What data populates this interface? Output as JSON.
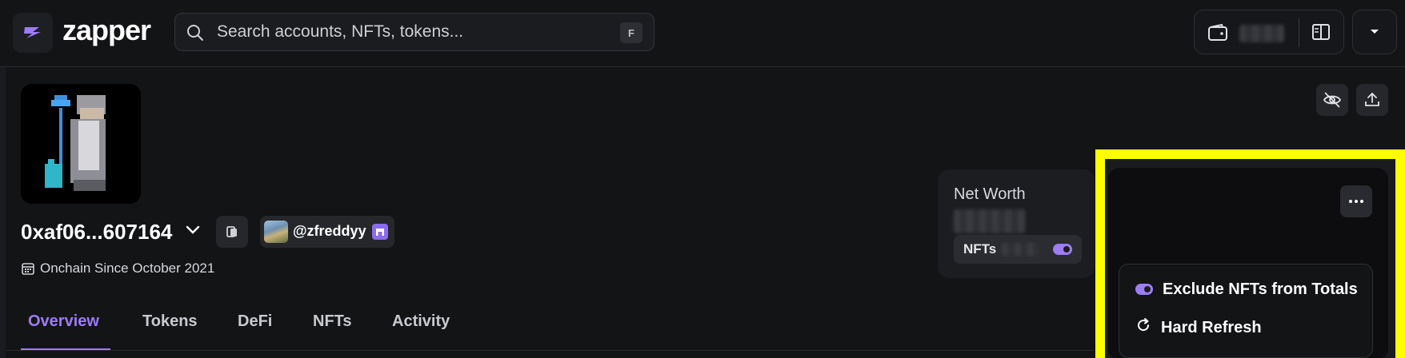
{
  "app": {
    "logo_text": "zapper"
  },
  "search": {
    "placeholder": "Search accounts, NFTs, tokens...",
    "shortcut": "F"
  },
  "profile": {
    "address": "0xaf06...607164",
    "handle": "@zfreddyy",
    "onchain_since": "Onchain Since October 2021"
  },
  "tabs": [
    {
      "label": "Overview",
      "active": true
    },
    {
      "label": "Tokens",
      "active": false
    },
    {
      "label": "DeFi",
      "active": false
    },
    {
      "label": "NFTs",
      "active": false
    },
    {
      "label": "Activity",
      "active": false
    }
  ],
  "networth": {
    "label": "Net Worth",
    "nfts_label": "NFTs",
    "nfts_toggle_on": true
  },
  "menu": {
    "items": [
      {
        "label": "Exclude NFTs from Totals",
        "icon": "toggle-icon"
      },
      {
        "label": "Hard Refresh",
        "icon": "refresh-icon"
      }
    ]
  },
  "colors": {
    "accent": "#9d7cf5",
    "highlight": "#ffff00",
    "background": "#131416"
  }
}
